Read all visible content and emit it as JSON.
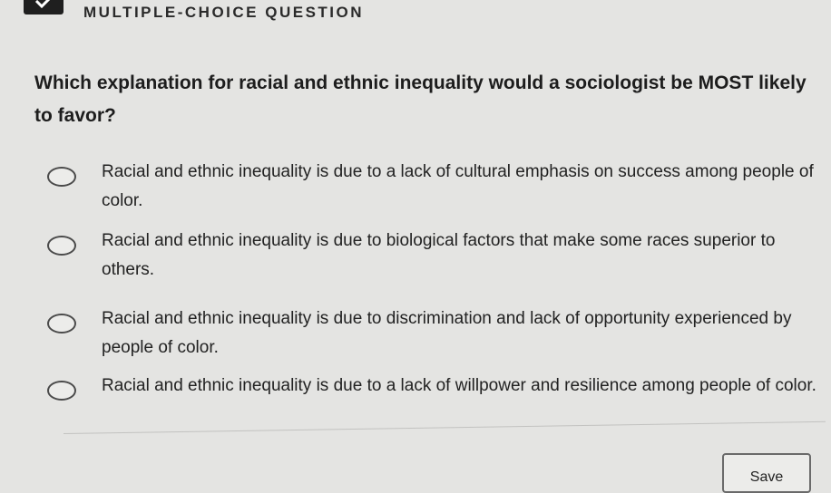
{
  "header": {
    "title": "MULTIPLE-CHOICE QUESTION"
  },
  "question": {
    "text": "Which explanation for racial and ethnic inequality would a sociologist be MOST likely to favor?"
  },
  "options": [
    {
      "label": "Racial and ethnic inequality is due to a lack of cultural emphasis on success among people of color."
    },
    {
      "label": "Racial and ethnic inequality is due to biological factors that make some races superior to others."
    },
    {
      "label": "Racial and ethnic inequality is due to discrimination and lack of opportunity experienced by people of color."
    },
    {
      "label": "Racial and ethnic inequality is due to a lack of willpower and resilience among people of color."
    }
  ],
  "actions": {
    "save_label": "Save"
  }
}
